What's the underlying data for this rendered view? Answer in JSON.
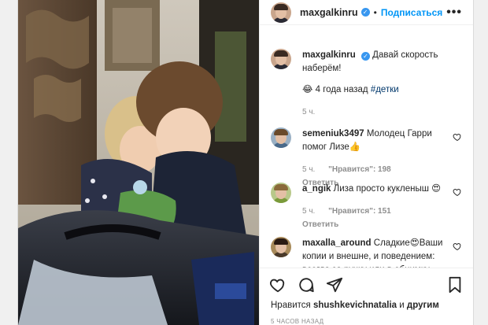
{
  "post": {
    "username": "maxgalkinru",
    "verified_mark": "✓",
    "separator": "•",
    "follow_label": "Подписаться",
    "more_label": "•••"
  },
  "caption": {
    "username": "maxgalkinru",
    "text": "Давай скорость наберём!",
    "emoji": "😂",
    "date_text": "4 года назад",
    "hashtag": "#детки",
    "time": "5 ч."
  },
  "comments": [
    {
      "username": "semeniuk3497",
      "text": "Молодец Гарри помог Лизе👍",
      "time": "5 ч.",
      "likes": "\"Нравится\": 198",
      "reply": "Ответить"
    },
    {
      "username": "a_ngik",
      "text": "Лиза просто кукленыш 😍",
      "time": "5 ч.",
      "likes": "\"Нравится\": 151",
      "reply": "Ответить"
    },
    {
      "username": "maxalla_around",
      "text": "Сладкие😍Ваши копии и внешне, и поведением: всегда за ручку или в обнимку"
    }
  ],
  "footer": {
    "likes_prefix": "Нравится",
    "likes_user": "shushkevichnatalia",
    "likes_and": "и",
    "likes_others": "другим",
    "timestamp": "5 ЧАСОВ НАЗАД"
  },
  "colors": {
    "accent": "#0095f6",
    "verified": "#3897f0",
    "muted": "#8e8e8e",
    "hashtag": "#00376b"
  },
  "icons": {
    "like": "heart-icon",
    "comment": "comment-icon",
    "share": "share-icon",
    "save": "bookmark-icon"
  }
}
